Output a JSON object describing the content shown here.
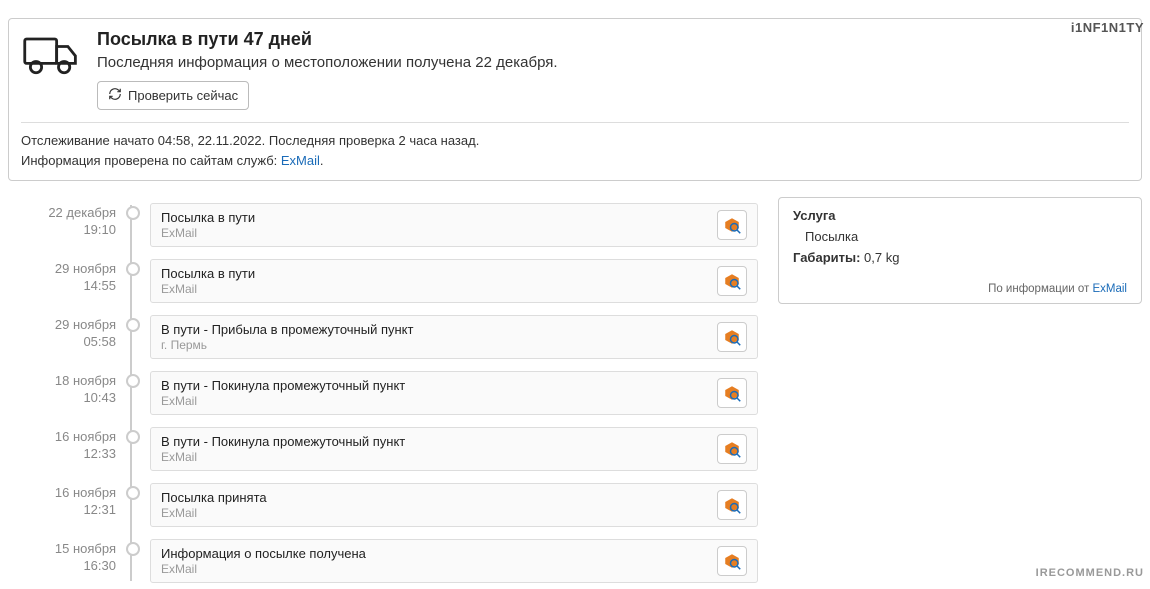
{
  "watermarks": {
    "top": "i1NF1N1TY",
    "bottom": "IRECOMMEND.RU"
  },
  "status": {
    "title": "Посылка в пути 47 дней",
    "subtitle": "Последняя информация о местоположении получена 22 декабря.",
    "refresh_label": "Проверить сейчас",
    "meta_line1": "Отслеживание начато 04:58, 22.11.2022. Последняя проверка 2 часа назад.",
    "meta_line2_prefix": "Информация проверена по сайтам служб: ",
    "meta_service": "ExMail",
    "meta_suffix": "."
  },
  "timeline": [
    {
      "date": "22 декабря",
      "time": "19:10",
      "title": "Посылка в пути",
      "sub": "ExMail"
    },
    {
      "date": "29 ноября",
      "time": "14:55",
      "title": "Посылка в пути",
      "sub": "ExMail"
    },
    {
      "date": "29 ноября",
      "time": "05:58",
      "title": "В пути - Прибыла в промежуточный пункт",
      "sub": "г. Пермь"
    },
    {
      "date": "18 ноября",
      "time": "10:43",
      "title": "В пути - Покинула промежуточный пункт",
      "sub": "ExMail"
    },
    {
      "date": "16 ноября",
      "time": "12:33",
      "title": "В пути - Покинула промежуточный пункт",
      "sub": "ExMail"
    },
    {
      "date": "16 ноября",
      "time": "12:31",
      "title": "Посылка принята",
      "sub": "ExMail"
    },
    {
      "date": "15 ноября",
      "time": "16:30",
      "title": "Информация о посылке получена",
      "sub": "ExMail"
    }
  ],
  "side": {
    "service_label": "Услуга",
    "service_value": "Посылка",
    "dims_label": "Габариты:",
    "dims_value": "0,7 kg",
    "footer_prefix": "По информации от ",
    "footer_link": "ExMail"
  }
}
